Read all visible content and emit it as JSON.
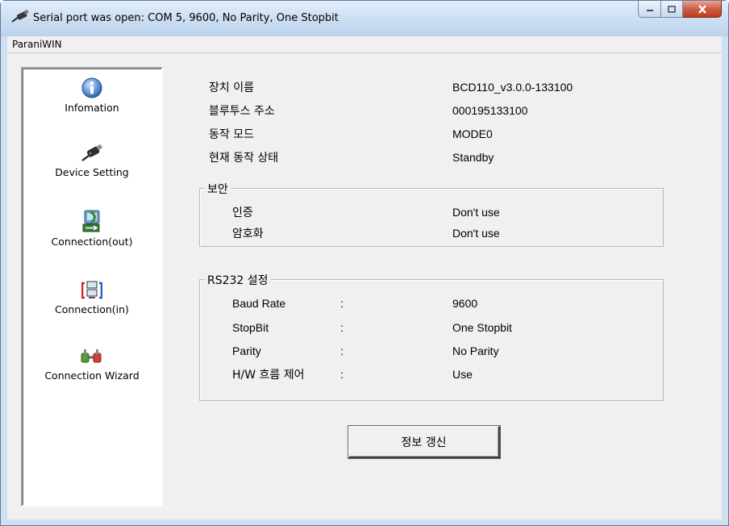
{
  "window": {
    "title": "Serial port was open: COM 5, 9600, No Parity, One Stopbit"
  },
  "menu": {
    "app_name": "ParaniWIN"
  },
  "sidebar": {
    "items": [
      {
        "label": "Infomation",
        "icon": "info-icon"
      },
      {
        "label": "Device Setting",
        "icon": "device-dongle-icon"
      },
      {
        "label": "Connection(out)",
        "icon": "connection-out-icon"
      },
      {
        "label": "Connection(in)",
        "icon": "connection-in-icon"
      },
      {
        "label": "Connection Wizard",
        "icon": "connection-wizard-icon"
      }
    ]
  },
  "device_info": {
    "rows": [
      {
        "label": "장치 이름",
        "value": "BCD110_v3.0.0-133100"
      },
      {
        "label": "블루투스 주소",
        "value": "000195133100"
      },
      {
        "label": "동작 모드",
        "value": "MODE0"
      },
      {
        "label": "현재 동작 상태",
        "value": "Standby"
      }
    ]
  },
  "security": {
    "title": "보안",
    "rows": [
      {
        "label": "인증",
        "value": "Don't use"
      },
      {
        "label": "암호화",
        "value": "Don't use"
      }
    ]
  },
  "rs232": {
    "title": "RS232 설정",
    "separator": ":",
    "rows": [
      {
        "label": "Baud Rate",
        "value": "9600"
      },
      {
        "label": "StopBit",
        "value": "One Stopbit"
      },
      {
        "label": "Parity",
        "value": "No Parity"
      },
      {
        "label": "H/W 흐름 제어",
        "value": "Use"
      }
    ]
  },
  "actions": {
    "refresh_label": "정보 갱신"
  },
  "colors": {
    "frame": "#cfe0f3",
    "close_button": "#c94a32",
    "panel": "#f0f0f0"
  }
}
